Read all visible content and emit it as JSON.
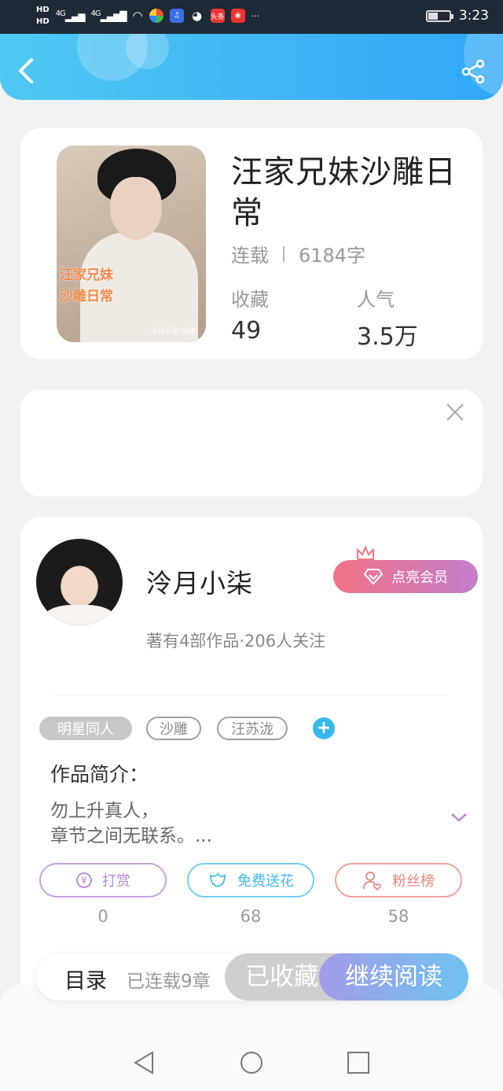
{
  "status_bar": {
    "hd_top": "HD",
    "hd_bottom": "HD",
    "net1": "4G",
    "net2": "4G",
    "app_icons": [
      "color-wheel-icon",
      "music-app-icon",
      "wechat-icon",
      "toutiao-icon",
      "weibo-icon"
    ],
    "toutiao_text": "头条",
    "more": "···",
    "battery_level": 0.45,
    "time": "3:23"
  },
  "book": {
    "title": "汪家兄妹沙雕日常",
    "status": "连载",
    "word_count": "6184字",
    "favorites_label": "收藏",
    "favorites_value": "49",
    "popularity_label": "人气",
    "popularity_value": "3.5万",
    "cover_text_line1": "汪家兄妹",
    "cover_text_line2": "沙雕日常",
    "cover_signature": "泠月小柒*执笔"
  },
  "author": {
    "name": "泠月小柒",
    "summary": "著有4部作品·206人关注",
    "vip_label": "点亮会员"
  },
  "tags": [
    "明星同人",
    "沙雕",
    "汪苏泷"
  ],
  "add_tag": "+",
  "intro": {
    "title": "作品简介：",
    "line1": "勿上升真人，",
    "line2": "章节之间无联系。..."
  },
  "actions": {
    "tip_label": "打赏",
    "tip_count": "0",
    "flower_label": "免费送花",
    "flower_count": "68",
    "fans_label": "粉丝榜",
    "fans_count": "58"
  },
  "bottom_bar": {
    "toc_label": "目录",
    "toc_sub": "已连载9章",
    "fav_label": "已收藏",
    "read_label": "继续阅读"
  },
  "colors": {
    "header": "#3fb3f5",
    "tip": "#b584d8",
    "flower": "#45b9ec",
    "fans": "#e6857e"
  }
}
